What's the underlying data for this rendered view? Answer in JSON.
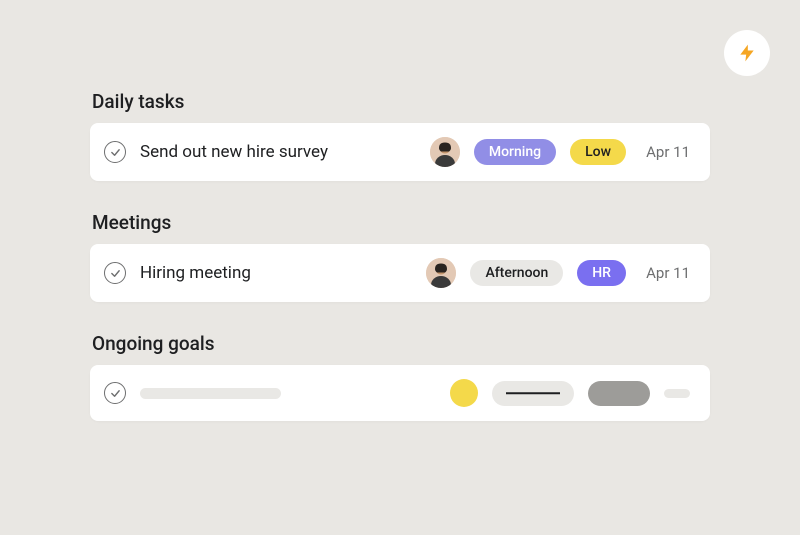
{
  "sections": {
    "daily": {
      "title": "Daily tasks",
      "task": {
        "name": "Send out new hire survey",
        "timeTag": "Morning",
        "priorityTag": "Low",
        "date": "Apr 11"
      }
    },
    "meetings": {
      "title": "Meetings",
      "task": {
        "name": "Hiring meeting",
        "timeTag": "Afternoon",
        "categoryTag": "HR",
        "date": "Apr 11"
      }
    },
    "goals": {
      "title": "Ongoing goals"
    }
  },
  "colors": {
    "purpleSolid": "#918ee6",
    "yellow": "#f4d94a",
    "grayLight": "#e9e8e5",
    "purple2": "#7a6ff0",
    "accentOrange": "#f5a623"
  }
}
